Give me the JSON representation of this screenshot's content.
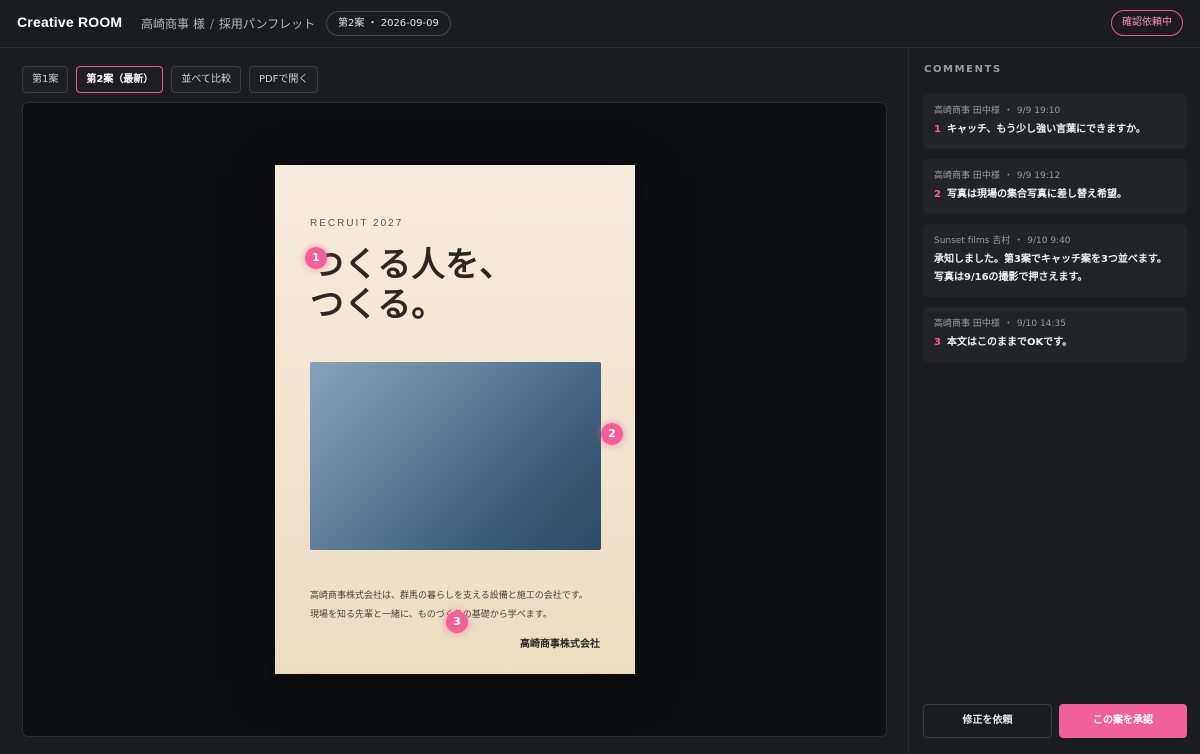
{
  "header": {
    "brand": "Creative ROOM",
    "client": "高崎商事 様",
    "separator": "/",
    "project": "採用パンフレット",
    "version_pill": "第2案 ・ 2026-09-09",
    "status": "確認依頼中"
  },
  "tabs": [
    {
      "label": "第1案"
    },
    {
      "label": "第2案（最新）"
    },
    {
      "label": "並べて比較"
    },
    {
      "label": "PDFで開く"
    }
  ],
  "pamphlet": {
    "kicker": "RECRUIT 2027",
    "headline_line1": "つくる人を、",
    "headline_line2": "つくる。",
    "body_line1": "高崎商事株式会社は、群馬の暮らしを支える設備と施工の会社です。",
    "body_line2": "現場を知る先輩と一緒に、ものづくりの基礎から学べます。",
    "company": "高崎商事株式会社"
  },
  "pins": [
    "1",
    "2",
    "3"
  ],
  "sidebar": {
    "title": "COMMENTS",
    "comments": [
      {
        "author": "高崎商事 田中様",
        "time": "9/9 19:10",
        "num": "1",
        "text": "キャッチ、もう少し強い言葉にできますか。",
        "text2": ""
      },
      {
        "author": "高崎商事 田中様",
        "time": "9/9 19:12",
        "num": "2",
        "text": "写真は現場の集合写真に差し替え希望。",
        "text2": ""
      },
      {
        "author": "Sunset films 吉村",
        "time": "9/10 9:40",
        "num": "",
        "text": "承知しました。第3案でキャッチ案を3つ並べます。",
        "text2": "写真は9/16の撮影で押さえます。"
      },
      {
        "author": "高崎商事 田中様",
        "time": "9/10 14:35",
        "num": "3",
        "text": "本文はこのままでOKです。",
        "text2": ""
      }
    ],
    "request_changes": "修正を依頼",
    "approve": "この案を承認"
  },
  "colors": {
    "accent": "#f2609a",
    "background": "#1b1c1f",
    "card": "#232428"
  }
}
